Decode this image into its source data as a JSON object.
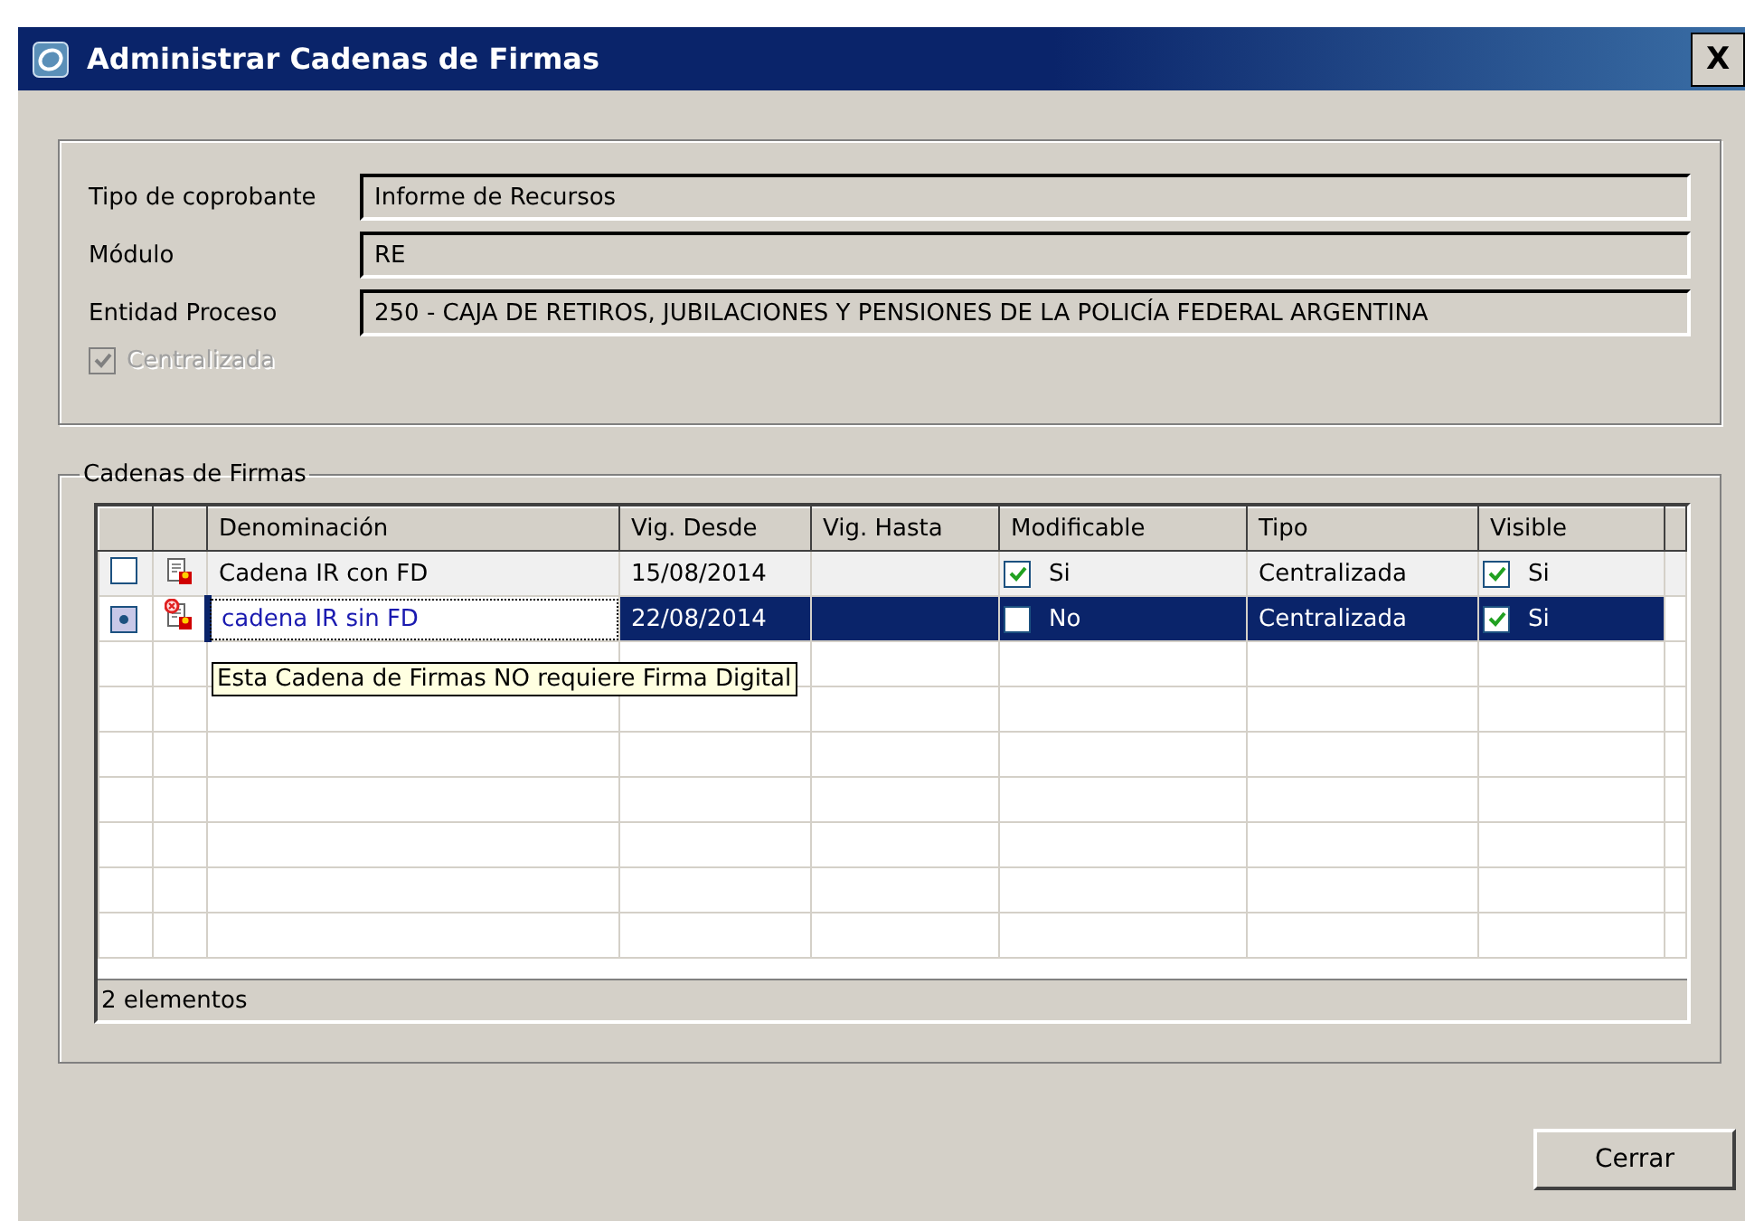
{
  "window": {
    "title": "Administrar Cadenas de Firmas",
    "close": "X"
  },
  "fields": [
    {
      "label": "Tipo de coprobante",
      "value": "Informe de Recursos"
    },
    {
      "label": "Módulo",
      "value": "RE"
    },
    {
      "label": "Entidad Proceso",
      "value": "250 - CAJA DE RETIROS, JUBILACIONES Y PENSIONES DE LA POLICÍA FEDERAL ARGENTINA"
    }
  ],
  "centralizada": {
    "label": "Centralizada",
    "checked": true,
    "disabled": true
  },
  "group": {
    "title": "Cadenas de Firmas"
  },
  "table": {
    "columns": [
      "Denominación",
      "Vig. Desde",
      "Vig. Hasta",
      "Modificable",
      "Tipo",
      "Visible"
    ],
    "rows": [
      {
        "selected": false,
        "digital_signature": true,
        "name": "Cadena IR con FD",
        "desde": "15/08/2014",
        "hasta": "",
        "modificable": {
          "checked": true,
          "text": "Si"
        },
        "tipo": "Centralizada",
        "visible": {
          "checked": true,
          "text": "Si"
        }
      },
      {
        "selected": true,
        "digital_signature": false,
        "name": "cadena IR sin FD",
        "desde": "22/08/2014",
        "hasta": "",
        "modificable": {
          "checked": false,
          "text": "No"
        },
        "tipo": "Centralizada",
        "visible": {
          "checked": true,
          "text": "Si"
        }
      }
    ],
    "footer": "2 elementos"
  },
  "tooltip": "Esta Cadena de Firmas NO requiere Firma Digital",
  "buttons": [
    "Cerrar"
  ]
}
